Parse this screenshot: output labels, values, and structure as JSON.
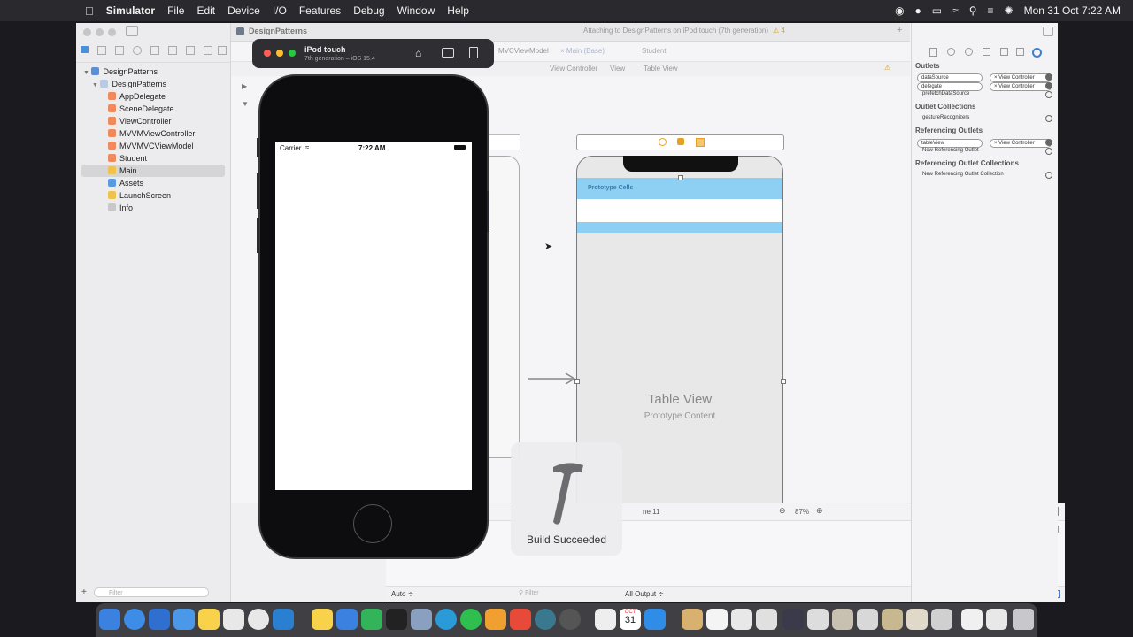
{
  "menubar": {
    "app_name": "Simulator",
    "items": [
      "File",
      "Edit",
      "Device",
      "I/O",
      "Features",
      "Debug",
      "Window",
      "Help"
    ],
    "clock": "Mon 31 Oct  7:22 AM"
  },
  "xcode": {
    "scheme_title": "DesignPatterns",
    "activity_status": "Attaching to DesignPatterns on iPod touch (7th generation)",
    "warning_count": "4",
    "tabs": [
      "MVCViewModel",
      "Main (Base)",
      "Student"
    ],
    "jump_path": [
      "View Controller",
      "View",
      "Table View"
    ],
    "file_tree": [
      {
        "label": "DesignPatterns",
        "level": 0,
        "kind": "project"
      },
      {
        "label": "DesignPatterns",
        "level": 1,
        "kind": "folder"
      },
      {
        "label": "AppDelegate",
        "level": 2,
        "kind": "swift"
      },
      {
        "label": "SceneDelegate",
        "level": 2,
        "kind": "swift"
      },
      {
        "label": "ViewController",
        "level": 2,
        "kind": "swift"
      },
      {
        "label": "MVVMViewController",
        "level": 2,
        "kind": "swift"
      },
      {
        "label": "MVVMVCViewModel",
        "level": 2,
        "kind": "swift"
      },
      {
        "label": "Student",
        "level": 2,
        "kind": "swift"
      },
      {
        "label": "Main",
        "level": 2,
        "kind": "storyboard",
        "selected": true
      },
      {
        "label": "Assets",
        "level": 2,
        "kind": "assets"
      },
      {
        "label": "LaunchScreen",
        "level": 2,
        "kind": "storyboard"
      },
      {
        "label": "Info",
        "level": 2,
        "kind": "plist"
      }
    ],
    "canvas": {
      "prototype_cells_label": "Prototype Cells",
      "table_view_title": "Table View",
      "table_view_subtitle": "Prototype Content",
      "zoom": "87%",
      "line_label": "ne 11"
    },
    "debug": {
      "auto_label": "Auto ≑",
      "filter_placeholder": "Filter",
      "output_label": "All Output ≑"
    },
    "nav_filter_placeholder": "Filter",
    "inspector": {
      "outlets_header": "Outlets",
      "outlets": [
        {
          "name": "dataSource",
          "target": "View Controller"
        },
        {
          "name": "delegate",
          "target": "View Controller"
        },
        {
          "name": "prefetchDataSource",
          "target": ""
        }
      ],
      "outlet_collections_header": "Outlet Collections",
      "outlet_collections": [
        "gestureRecognizers"
      ],
      "referencing_outlets_header": "Referencing Outlets",
      "referencing_outlets": [
        {
          "name": "tableView",
          "target": "View Controller"
        },
        {
          "name": "New Referencing Outlet",
          "target": ""
        }
      ],
      "referencing_collections_header": "Referencing Outlet Collections",
      "referencing_collections": [
        "New Referencing Outlet Collection"
      ]
    }
  },
  "simulator": {
    "device_name": "iPod touch",
    "device_sub": "7th generation – iOS 15.4",
    "status_carrier": "Carrier",
    "status_time": "7:22 AM"
  },
  "build_hud": {
    "label": "Build Succeeded"
  },
  "dock": {
    "calendar_month": "OCT",
    "calendar_day": "31"
  }
}
